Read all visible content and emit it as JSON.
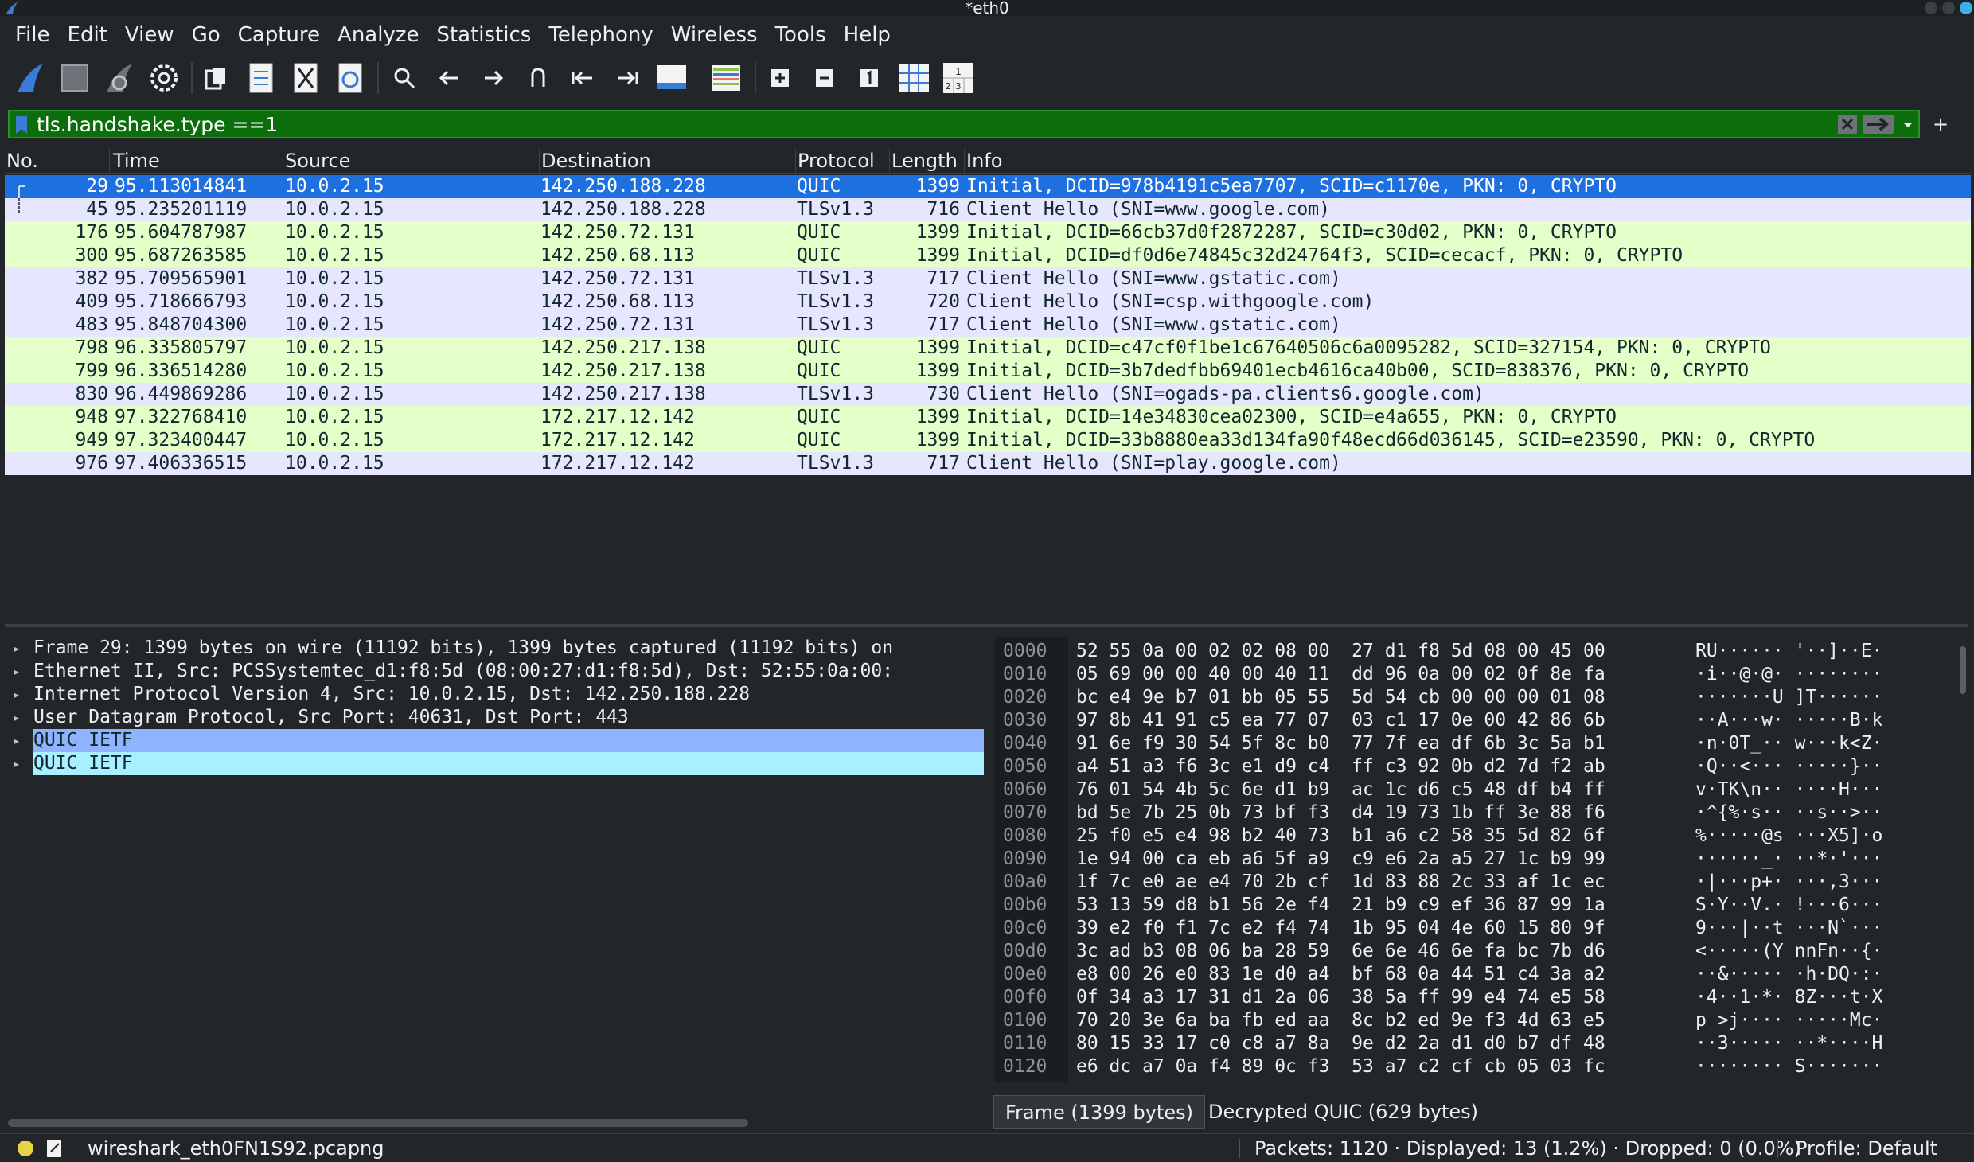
{
  "window": {
    "title": "*eth0"
  },
  "menu": [
    "File",
    "Edit",
    "View",
    "Go",
    "Capture",
    "Analyze",
    "Statistics",
    "Telephony",
    "Wireless",
    "Tools",
    "Help"
  ],
  "filter": {
    "value": "tls.handshake.type ==1"
  },
  "columns": {
    "no": "No.",
    "time": "Time",
    "source": "Source",
    "destination": "Destination",
    "protocol": "Protocol",
    "length": "Length",
    "info": "Info"
  },
  "packets": [
    {
      "no": "29",
      "time": "95.113014841",
      "source": "10.0.2.15",
      "destination": "142.250.188.228",
      "protocol": "QUIC",
      "length": "1399",
      "info": "Initial, DCID=978b4191c5ea7707, SCID=c1170e, PKN: 0, CRYPTO"
    },
    {
      "no": "45",
      "time": "95.235201119",
      "source": "10.0.2.15",
      "destination": "142.250.188.228",
      "protocol": "TLSv1.3",
      "length": "716",
      "info": "Client Hello (SNI=www.google.com)"
    },
    {
      "no": "176",
      "time": "95.604787987",
      "source": "10.0.2.15",
      "destination": "142.250.72.131",
      "protocol": "QUIC",
      "length": "1399",
      "info": "Initial, DCID=66cb37d0f2872287, SCID=c30d02, PKN: 0, CRYPTO"
    },
    {
      "no": "300",
      "time": "95.687263585",
      "source": "10.0.2.15",
      "destination": "142.250.68.113",
      "protocol": "QUIC",
      "length": "1399",
      "info": "Initial, DCID=df0d6e74845c32d24764f3, SCID=cecacf, PKN: 0, CRYPTO"
    },
    {
      "no": "382",
      "time": "95.709565901",
      "source": "10.0.2.15",
      "destination": "142.250.72.131",
      "protocol": "TLSv1.3",
      "length": "717",
      "info": "Client Hello (SNI=www.gstatic.com)"
    },
    {
      "no": "409",
      "time": "95.718666793",
      "source": "10.0.2.15",
      "destination": "142.250.68.113",
      "protocol": "TLSv1.3",
      "length": "720",
      "info": "Client Hello (SNI=csp.withgoogle.com)"
    },
    {
      "no": "483",
      "time": "95.848704300",
      "source": "10.0.2.15",
      "destination": "142.250.72.131",
      "protocol": "TLSv1.3",
      "length": "717",
      "info": "Client Hello (SNI=www.gstatic.com)"
    },
    {
      "no": "798",
      "time": "96.335805797",
      "source": "10.0.2.15",
      "destination": "142.250.217.138",
      "protocol": "QUIC",
      "length": "1399",
      "info": "Initial, DCID=c47cf0f1be1c67640506c6a0095282, SCID=327154, PKN: 0, CRYPTO"
    },
    {
      "no": "799",
      "time": "96.336514280",
      "source": "10.0.2.15",
      "destination": "142.250.217.138",
      "protocol": "QUIC",
      "length": "1399",
      "info": "Initial, DCID=3b7dedfbb69401ecb4616ca40b00, SCID=838376, PKN: 0, CRYPTO"
    },
    {
      "no": "830",
      "time": "96.449869286",
      "source": "10.0.2.15",
      "destination": "142.250.217.138",
      "protocol": "TLSv1.3",
      "length": "730",
      "info": "Client Hello (SNI=ogads-pa.clients6.google.com)"
    },
    {
      "no": "948",
      "time": "97.322768410",
      "source": "10.0.2.15",
      "destination": "172.217.12.142",
      "protocol": "QUIC",
      "length": "1399",
      "info": "Initial, DCID=14e34830cea02300, SCID=e4a655, PKN: 0, CRYPTO"
    },
    {
      "no": "949",
      "time": "97.323400447",
      "source": "10.0.2.15",
      "destination": "172.217.12.142",
      "protocol": "QUIC",
      "length": "1399",
      "info": "Initial, DCID=33b8880ea33d134fa90f48ecd66d036145, SCID=e23590, PKN: 0, CRYPTO"
    },
    {
      "no": "976",
      "time": "97.406336515",
      "source": "10.0.2.15",
      "destination": "172.217.12.142",
      "protocol": "TLSv1.3",
      "length": "717",
      "info": "Client Hello (SNI=play.google.com)"
    }
  ],
  "details": [
    "Frame 29: 1399 bytes on wire (11192 bits), 1399 bytes captured (11192 bits) on",
    "Ethernet II, Src: PCSSystemtec_d1:f8:5d (08:00:27:d1:f8:5d), Dst: 52:55:0a:00:",
    "Internet Protocol Version 4, Src: 10.0.2.15, Dst: 142.250.188.228",
    "User Datagram Protocol, Src Port: 40631, Dst Port: 443",
    "QUIC IETF",
    "QUIC IETF"
  ],
  "hex": [
    {
      "off": "0000",
      "hex": "52 55 0a 00 02 02 08 00  27 d1 f8 5d 08 00 45 00",
      "ascii": "RU······ '··]··E·"
    },
    {
      "off": "0010",
      "hex": "05 69 00 00 40 00 40 11  dd 96 0a 00 02 0f 8e fa",
      "ascii": "·i··@·@· ········"
    },
    {
      "off": "0020",
      "hex": "bc e4 9e b7 01 bb 05 55  5d 54 cb 00 00 00 01 08",
      "ascii": "·······U ]T······"
    },
    {
      "off": "0030",
      "hex": "97 8b 41 91 c5 ea 77 07  03 c1 17 0e 00 42 86 6b",
      "ascii": "··A···w· ·····B·k"
    },
    {
      "off": "0040",
      "hex": "91 6e f9 30 54 5f 8c b0  77 7f ea df 6b 3c 5a b1",
      "ascii": "·n·0T_·· w···k<Z·"
    },
    {
      "off": "0050",
      "hex": "a4 51 a3 f6 3c e1 d9 c4  ff c3 92 0b d2 7d f2 ab",
      "ascii": "·Q··<··· ·····}··"
    },
    {
      "off": "0060",
      "hex": "76 01 54 4b 5c 6e d1 b9  ac 1c d6 c5 48 df b4 ff",
      "ascii": "v·TK\\n·· ····H···"
    },
    {
      "off": "0070",
      "hex": "bd 5e 7b 25 0b 73 bf f3  d4 19 73 1b ff 3e 88 f6",
      "ascii": "·^{%·s·· ··s··>··"
    },
    {
      "off": "0080",
      "hex": "25 f0 e5 e4 98 b2 40 73  b1 a6 c2 58 35 5d 82 6f",
      "ascii": "%·····@s ···X5]·o"
    },
    {
      "off": "0090",
      "hex": "1e 94 00 ca eb a6 5f a9  c9 e6 2a a5 27 1c b9 99",
      "ascii": "······_· ··*·'···"
    },
    {
      "off": "00a0",
      "hex": "1f 7c e0 ae e4 70 2b cf  1d 83 88 2c 33 af 1c ec",
      "ascii": "·|···p+· ···,3···"
    },
    {
      "off": "00b0",
      "hex": "53 13 59 d8 b1 56 2e f4  21 b9 c9 ef 36 87 99 1a",
      "ascii": "S·Y··V.· !···6···"
    },
    {
      "off": "00c0",
      "hex": "39 e2 f0 f1 7c e2 f4 74  1b 95 04 4e 60 15 80 9f",
      "ascii": "9···|··t ···N`···"
    },
    {
      "off": "00d0",
      "hex": "3c ad b3 08 06 ba 28 59  6e 6e 46 6e fa bc 7b d6",
      "ascii": "<·····(Y nnFn··{·"
    },
    {
      "off": "00e0",
      "hex": "e8 00 26 e0 83 1e d0 a4  bf 68 0a 44 51 c4 3a a2",
      "ascii": "··&····· ·h·DQ·:·"
    },
    {
      "off": "00f0",
      "hex": "0f 34 a3 17 31 d1 2a 06  38 5a ff 99 e4 74 e5 58",
      "ascii": "·4··1·*· 8Z···t·X"
    },
    {
      "off": "0100",
      "hex": "70 20 3e 6a ba fb ed aa  8c b2 ed 9e f3 4d 63 e5",
      "ascii": "p >j···· ·····Mc·"
    },
    {
      "off": "0110",
      "hex": "80 15 33 17 c0 c8 a7 8a  9e d2 2a d1 d0 b7 df 48",
      "ascii": "··3····· ··*····H"
    },
    {
      "off": "0120",
      "hex": "e6 dc a7 0a f4 89 0c f3  53 a7 c2 cf cb 05 03 fc",
      "ascii": "········ S·······"
    }
  ],
  "bytes_tabs": [
    "Frame (1399 bytes)",
    "Decrypted QUIC (629 bytes)"
  ],
  "status": {
    "file": "wireshark_eth0FN1S92.pcapng",
    "packets": "Packets: 1120 · Displayed: 13 (1.2%) · Dropped: 0 (0.0%)",
    "profile": "Profile: Default"
  },
  "colors": {
    "selected_row": "#1e6fe0",
    "quic_row": "#e4ffc7",
    "tls_row": "#e7e6ff",
    "filter_valid": "#0b6e0b"
  }
}
